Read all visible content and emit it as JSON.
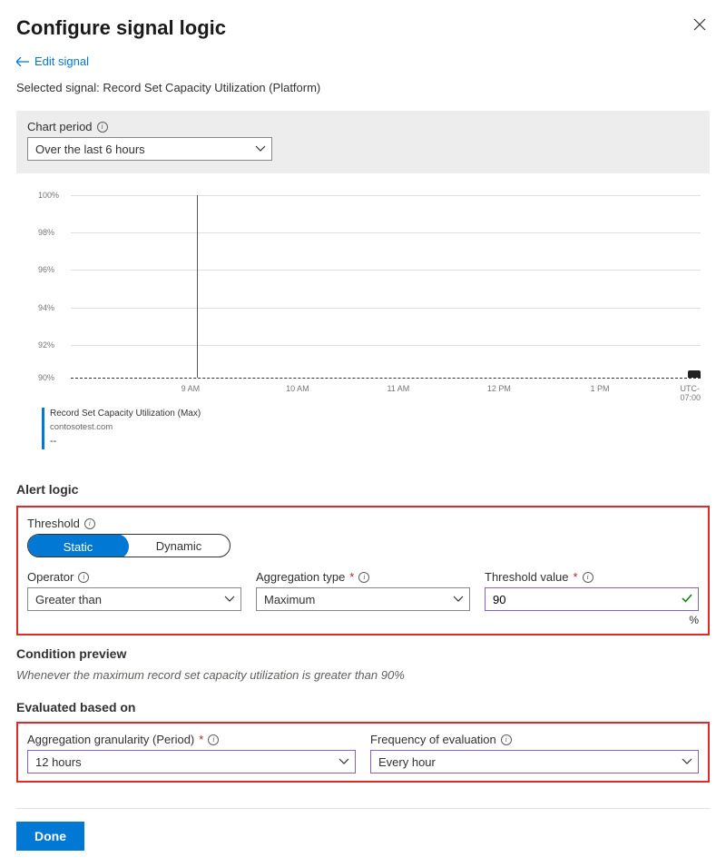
{
  "header": {
    "title": "Configure signal logic"
  },
  "backLink": "Edit signal",
  "selectedSignal": {
    "label": "Selected signal: ",
    "value": "Record Set Capacity Utilization (Platform)"
  },
  "chartPeriod": {
    "label": "Chart period",
    "value": "Over the last 6 hours"
  },
  "chart_data": {
    "type": "line",
    "title": "",
    "ylabel": "",
    "xlabel": "",
    "ylim": [
      90,
      100
    ],
    "y_ticks": [
      "100%",
      "98%",
      "96%",
      "94%",
      "92%",
      "90%"
    ],
    "x_ticks": [
      "9 AM",
      "10 AM",
      "11 AM",
      "12 PM",
      "1 PM",
      "UTC-07:00"
    ],
    "threshold_line": 90,
    "current_time_marker_x": "9 AM",
    "series": [
      {
        "name": "Record Set Capacity Utilization (Max)",
        "subtext": "contosotest.com",
        "current_value": "--",
        "values": []
      }
    ]
  },
  "alertLogic": {
    "sectionTitle": "Alert logic",
    "thresholdLabel": "Threshold",
    "toggle": {
      "options": [
        "Static",
        "Dynamic"
      ],
      "selected": "Static"
    },
    "operator": {
      "label": "Operator",
      "value": "Greater than"
    },
    "aggregationType": {
      "label": "Aggregation type",
      "value": "Maximum"
    },
    "thresholdValue": {
      "label": "Threshold value",
      "value": "90",
      "unit": "%"
    }
  },
  "conditionPreview": {
    "title": "Condition preview",
    "text": "Whenever the maximum record set capacity utilization is greater than 90%"
  },
  "evaluatedBasedOn": {
    "title": "Evaluated based on",
    "granularity": {
      "label": "Aggregation granularity (Period)",
      "value": "12 hours"
    },
    "frequency": {
      "label": "Frequency of evaluation",
      "value": "Every hour"
    }
  },
  "footer": {
    "done": "Done"
  }
}
